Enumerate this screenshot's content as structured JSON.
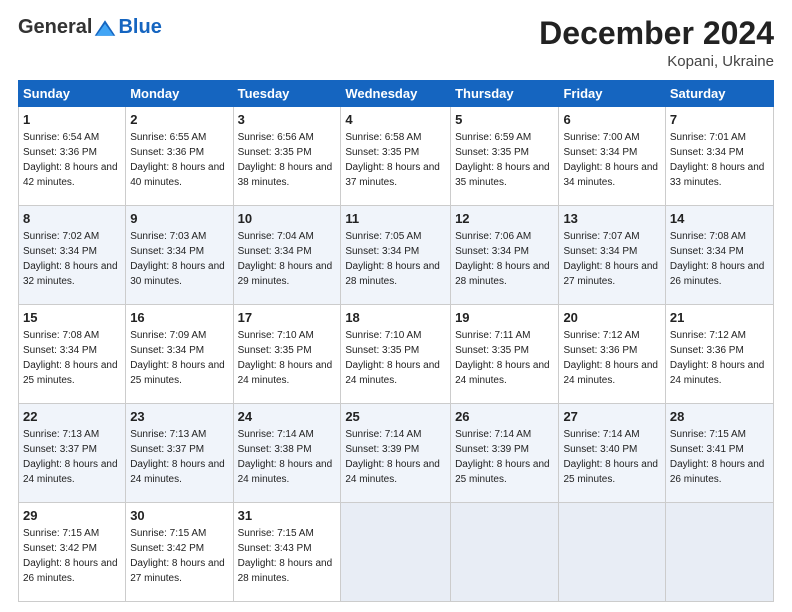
{
  "logo": {
    "general": "General",
    "blue": "Blue"
  },
  "title": "December 2024",
  "subtitle": "Kopani, Ukraine",
  "days_of_week": [
    "Sunday",
    "Monday",
    "Tuesday",
    "Wednesday",
    "Thursday",
    "Friday",
    "Saturday"
  ],
  "weeks": [
    [
      {
        "day": "1",
        "sunrise": "Sunrise: 6:54 AM",
        "sunset": "Sunset: 3:36 PM",
        "daylight": "Daylight: 8 hours and 42 minutes."
      },
      {
        "day": "2",
        "sunrise": "Sunrise: 6:55 AM",
        "sunset": "Sunset: 3:36 PM",
        "daylight": "Daylight: 8 hours and 40 minutes."
      },
      {
        "day": "3",
        "sunrise": "Sunrise: 6:56 AM",
        "sunset": "Sunset: 3:35 PM",
        "daylight": "Daylight: 8 hours and 38 minutes."
      },
      {
        "day": "4",
        "sunrise": "Sunrise: 6:58 AM",
        "sunset": "Sunset: 3:35 PM",
        "daylight": "Daylight: 8 hours and 37 minutes."
      },
      {
        "day": "5",
        "sunrise": "Sunrise: 6:59 AM",
        "sunset": "Sunset: 3:35 PM",
        "daylight": "Daylight: 8 hours and 35 minutes."
      },
      {
        "day": "6",
        "sunrise": "Sunrise: 7:00 AM",
        "sunset": "Sunset: 3:34 PM",
        "daylight": "Daylight: 8 hours and 34 minutes."
      },
      {
        "day": "7",
        "sunrise": "Sunrise: 7:01 AM",
        "sunset": "Sunset: 3:34 PM",
        "daylight": "Daylight: 8 hours and 33 minutes."
      }
    ],
    [
      {
        "day": "8",
        "sunrise": "Sunrise: 7:02 AM",
        "sunset": "Sunset: 3:34 PM",
        "daylight": "Daylight: 8 hours and 32 minutes."
      },
      {
        "day": "9",
        "sunrise": "Sunrise: 7:03 AM",
        "sunset": "Sunset: 3:34 PM",
        "daylight": "Daylight: 8 hours and 30 minutes."
      },
      {
        "day": "10",
        "sunrise": "Sunrise: 7:04 AM",
        "sunset": "Sunset: 3:34 PM",
        "daylight": "Daylight: 8 hours and 29 minutes."
      },
      {
        "day": "11",
        "sunrise": "Sunrise: 7:05 AM",
        "sunset": "Sunset: 3:34 PM",
        "daylight": "Daylight: 8 hours and 28 minutes."
      },
      {
        "day": "12",
        "sunrise": "Sunrise: 7:06 AM",
        "sunset": "Sunset: 3:34 PM",
        "daylight": "Daylight: 8 hours and 28 minutes."
      },
      {
        "day": "13",
        "sunrise": "Sunrise: 7:07 AM",
        "sunset": "Sunset: 3:34 PM",
        "daylight": "Daylight: 8 hours and 27 minutes."
      },
      {
        "day": "14",
        "sunrise": "Sunrise: 7:08 AM",
        "sunset": "Sunset: 3:34 PM",
        "daylight": "Daylight: 8 hours and 26 minutes."
      }
    ],
    [
      {
        "day": "15",
        "sunrise": "Sunrise: 7:08 AM",
        "sunset": "Sunset: 3:34 PM",
        "daylight": "Daylight: 8 hours and 25 minutes."
      },
      {
        "day": "16",
        "sunrise": "Sunrise: 7:09 AM",
        "sunset": "Sunset: 3:34 PM",
        "daylight": "Daylight: 8 hours and 25 minutes."
      },
      {
        "day": "17",
        "sunrise": "Sunrise: 7:10 AM",
        "sunset": "Sunset: 3:35 PM",
        "daylight": "Daylight: 8 hours and 24 minutes."
      },
      {
        "day": "18",
        "sunrise": "Sunrise: 7:10 AM",
        "sunset": "Sunset: 3:35 PM",
        "daylight": "Daylight: 8 hours and 24 minutes."
      },
      {
        "day": "19",
        "sunrise": "Sunrise: 7:11 AM",
        "sunset": "Sunset: 3:35 PM",
        "daylight": "Daylight: 8 hours and 24 minutes."
      },
      {
        "day": "20",
        "sunrise": "Sunrise: 7:12 AM",
        "sunset": "Sunset: 3:36 PM",
        "daylight": "Daylight: 8 hours and 24 minutes."
      },
      {
        "day": "21",
        "sunrise": "Sunrise: 7:12 AM",
        "sunset": "Sunset: 3:36 PM",
        "daylight": "Daylight: 8 hours and 24 minutes."
      }
    ],
    [
      {
        "day": "22",
        "sunrise": "Sunrise: 7:13 AM",
        "sunset": "Sunset: 3:37 PM",
        "daylight": "Daylight: 8 hours and 24 minutes."
      },
      {
        "day": "23",
        "sunrise": "Sunrise: 7:13 AM",
        "sunset": "Sunset: 3:37 PM",
        "daylight": "Daylight: 8 hours and 24 minutes."
      },
      {
        "day": "24",
        "sunrise": "Sunrise: 7:14 AM",
        "sunset": "Sunset: 3:38 PM",
        "daylight": "Daylight: 8 hours and 24 minutes."
      },
      {
        "day": "25",
        "sunrise": "Sunrise: 7:14 AM",
        "sunset": "Sunset: 3:39 PM",
        "daylight": "Daylight: 8 hours and 24 minutes."
      },
      {
        "day": "26",
        "sunrise": "Sunrise: 7:14 AM",
        "sunset": "Sunset: 3:39 PM",
        "daylight": "Daylight: 8 hours and 25 minutes."
      },
      {
        "day": "27",
        "sunrise": "Sunrise: 7:14 AM",
        "sunset": "Sunset: 3:40 PM",
        "daylight": "Daylight: 8 hours and 25 minutes."
      },
      {
        "day": "28",
        "sunrise": "Sunrise: 7:15 AM",
        "sunset": "Sunset: 3:41 PM",
        "daylight": "Daylight: 8 hours and 26 minutes."
      }
    ],
    [
      {
        "day": "29",
        "sunrise": "Sunrise: 7:15 AM",
        "sunset": "Sunset: 3:42 PM",
        "daylight": "Daylight: 8 hours and 26 minutes."
      },
      {
        "day": "30",
        "sunrise": "Sunrise: 7:15 AM",
        "sunset": "Sunset: 3:42 PM",
        "daylight": "Daylight: 8 hours and 27 minutes."
      },
      {
        "day": "31",
        "sunrise": "Sunrise: 7:15 AM",
        "sunset": "Sunset: 3:43 PM",
        "daylight": "Daylight: 8 hours and 28 minutes."
      },
      null,
      null,
      null,
      null
    ]
  ]
}
